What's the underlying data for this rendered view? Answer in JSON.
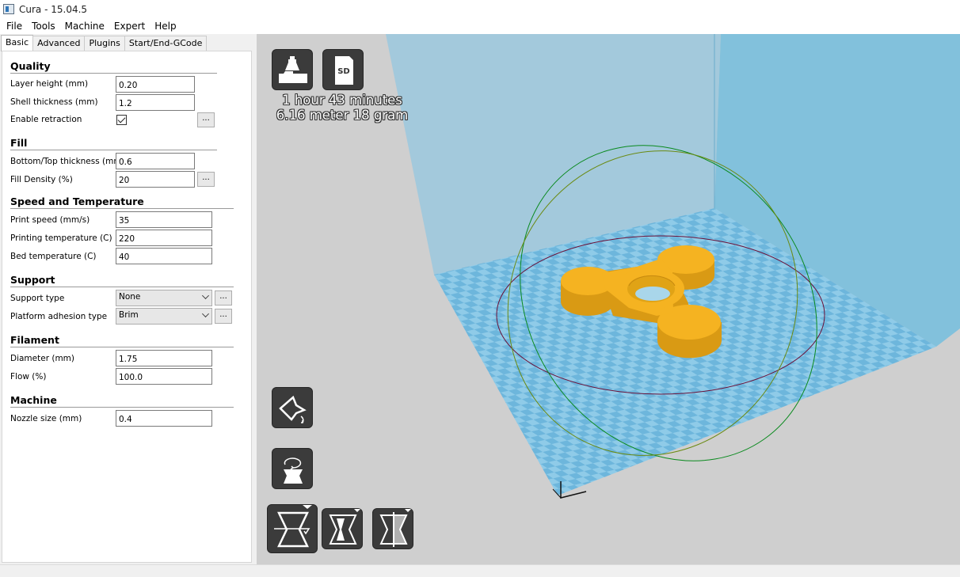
{
  "window": {
    "title": "Cura - 15.04.5"
  },
  "menu": [
    "File",
    "Tools",
    "Machine",
    "Expert",
    "Help"
  ],
  "tabs": [
    "Basic",
    "Advanced",
    "Plugins",
    "Start/End-GCode"
  ],
  "sections": {
    "quality": {
      "title": "Quality",
      "layer_height": {
        "label": "Layer height (mm)",
        "value": "0.20"
      },
      "shell_thickness": {
        "label": "Shell thickness (mm)",
        "value": "1.2"
      },
      "enable_retraction": {
        "label": "Enable retraction",
        "checked": true
      }
    },
    "fill": {
      "title": "Fill",
      "bottom_top_thickness": {
        "label": "Bottom/Top thickness (mm)",
        "value": "0.6"
      },
      "fill_density": {
        "label": "Fill Density (%)",
        "value": "20"
      }
    },
    "speed": {
      "title": "Speed and Temperature",
      "print_speed": {
        "label": "Print speed (mm/s)",
        "value": "35"
      },
      "printing_temperature": {
        "label": "Printing temperature (C)",
        "value": "220"
      },
      "bed_temperature": {
        "label": "Bed temperature (C)",
        "value": "40"
      }
    },
    "support": {
      "title": "Support",
      "support_type": {
        "label": "Support type",
        "value": "None"
      },
      "platform_adhesion": {
        "label": "Platform adhesion type",
        "value": "Brim"
      }
    },
    "filament": {
      "title": "Filament",
      "diameter": {
        "label": "Diameter (mm)",
        "value": "1.75"
      },
      "flow": {
        "label": "Flow (%)",
        "value": "100.0"
      }
    },
    "machine": {
      "title": "Machine",
      "nozzle_size": {
        "label": "Nozzle size (mm)",
        "value": "0.4"
      }
    }
  },
  "buttons": {
    "more": "..."
  },
  "viewport": {
    "print_time": "1 hour 43 minutes",
    "print_material": "6.16 meter 18 gram",
    "sd_label": "SD"
  },
  "colors": {
    "model": "#f5b321",
    "bed_light": "#8fcbe8",
    "bed_dark": "#6db6dc",
    "wall_left": "#a3c9dc",
    "wall_right": "#82c1dc"
  },
  "icons": {
    "load": "load-model-icon",
    "sd": "sd-card-icon",
    "view_mode": "view-mode-icon",
    "rotate": "rotate-tool-icon",
    "scale": "scale-tool-icon",
    "mirror": "mirror-tool-icon",
    "transform": "transform-tool-icon"
  }
}
